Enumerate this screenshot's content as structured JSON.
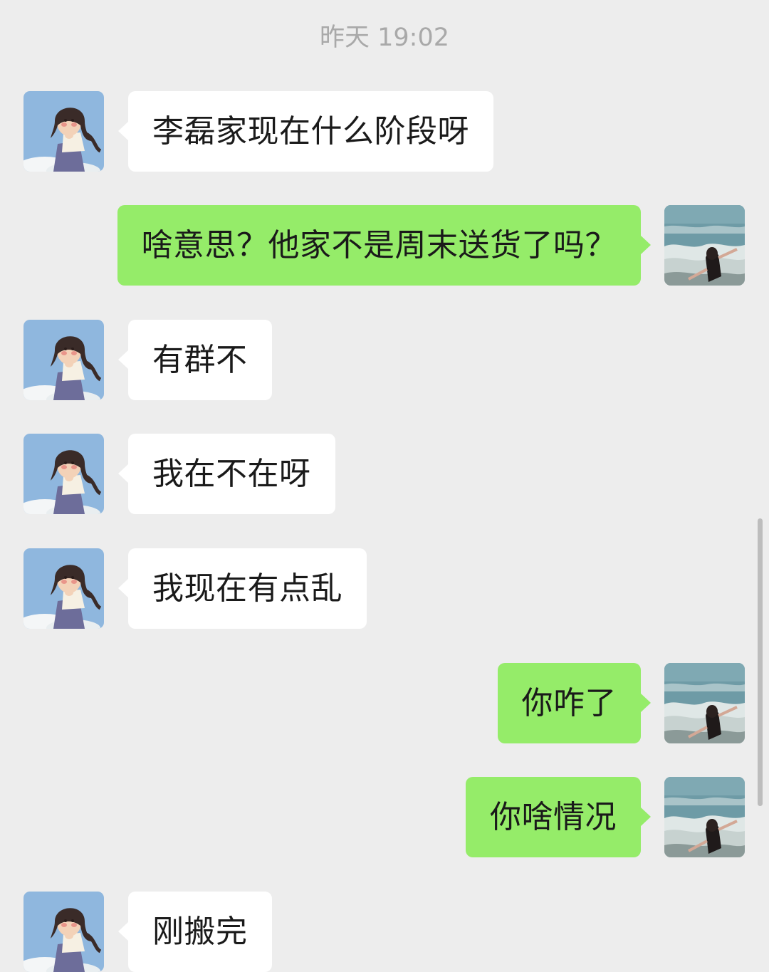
{
  "chat": {
    "timestamp": "昨天 19:02",
    "messages": [
      {
        "side": "left",
        "text": "李磊家现在什么阶段呀",
        "avatar": "girl-cartoon-avatar-icon"
      },
      {
        "side": "right",
        "text": "啥意思？他家不是周末送货了吗？",
        "avatar": "sea-photo-avatar-icon"
      },
      {
        "side": "left",
        "text": "有群不",
        "avatar": "girl-cartoon-avatar-icon"
      },
      {
        "side": "left",
        "text": "我在不在呀",
        "avatar": "girl-cartoon-avatar-icon"
      },
      {
        "side": "left",
        "text": "我现在有点乱",
        "avatar": "girl-cartoon-avatar-icon"
      },
      {
        "side": "right",
        "text": "你咋了",
        "avatar": "sea-photo-avatar-icon"
      },
      {
        "side": "right",
        "text": "你啥情况",
        "avatar": "sea-photo-avatar-icon"
      },
      {
        "side": "left",
        "text": "刚搬完",
        "avatar": "girl-cartoon-avatar-icon"
      }
    ]
  },
  "colors": {
    "background": "#ededed",
    "incoming_bubble": "#ffffff",
    "outgoing_bubble": "#95ec69",
    "timestamp_text": "#a9a9a9"
  }
}
